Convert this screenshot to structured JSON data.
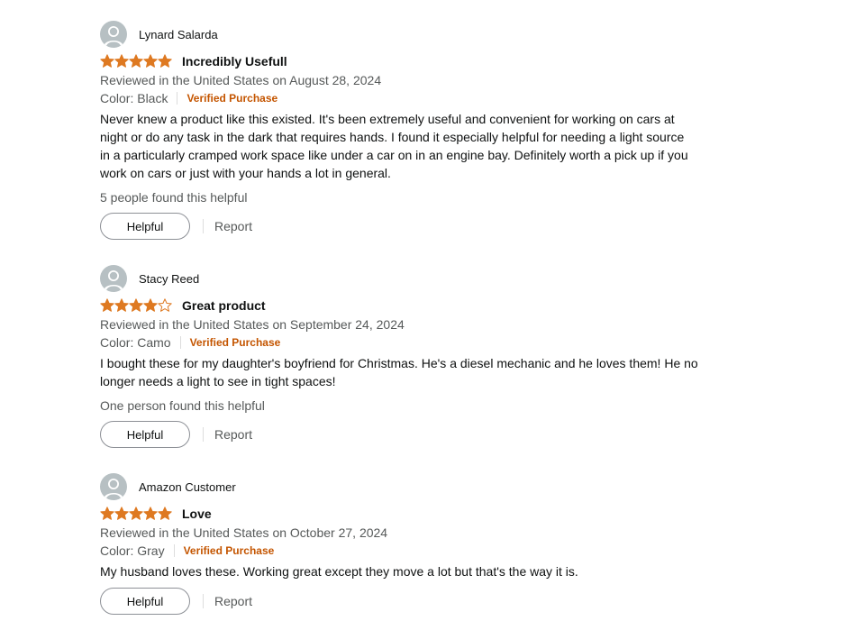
{
  "colors": {
    "star": "#de7921",
    "verified": "#c45500",
    "muted": "#565959"
  },
  "reviews": [
    {
      "name": "Lynard Salarda",
      "rating": 5,
      "title": "Incredibly Usefull",
      "date": "Reviewed in the United States on August 28, 2024",
      "color": "Color: Black",
      "verified": "Verified Purchase",
      "body_lines": [
        "Never knew a product like this existed. It's been extremely useful and convenient for working on cars at",
        "night or do any task in the dark that requires hands. I found it especially helpful for needing a light source",
        "in a particularly cramped work space like under a car on in an engine bay. Definitely worth a pick up if you",
        "work on cars or just with your hands a lot in general."
      ],
      "helpful_count": "5 people found this helpful",
      "helpful_label": "Helpful",
      "report_label": "Report"
    },
    {
      "name": "Stacy Reed",
      "rating": 4,
      "title": "Great product",
      "date": "Reviewed in the United States on September 24, 2024",
      "color": "Color: Camo",
      "verified": "Verified Purchase",
      "body_lines": [
        "I bought these for my daughter's boyfriend for Christmas. He's a diesel mechanic and he loves them! He no",
        "longer needs a light to see in tight spaces!"
      ],
      "helpful_count": "One person found this helpful",
      "helpful_label": "Helpful",
      "report_label": "Report"
    },
    {
      "name": "Amazon Customer",
      "rating": 5,
      "title": "Love",
      "date": "Reviewed in the United States on October 27, 2024",
      "color": "Color: Gray",
      "verified": "Verified Purchase",
      "body_lines": [
        "My husband loves these. Working great except they move a lot but that's the way it is."
      ],
      "helpful_count": "",
      "helpful_label": "Helpful",
      "report_label": "Report"
    }
  ]
}
